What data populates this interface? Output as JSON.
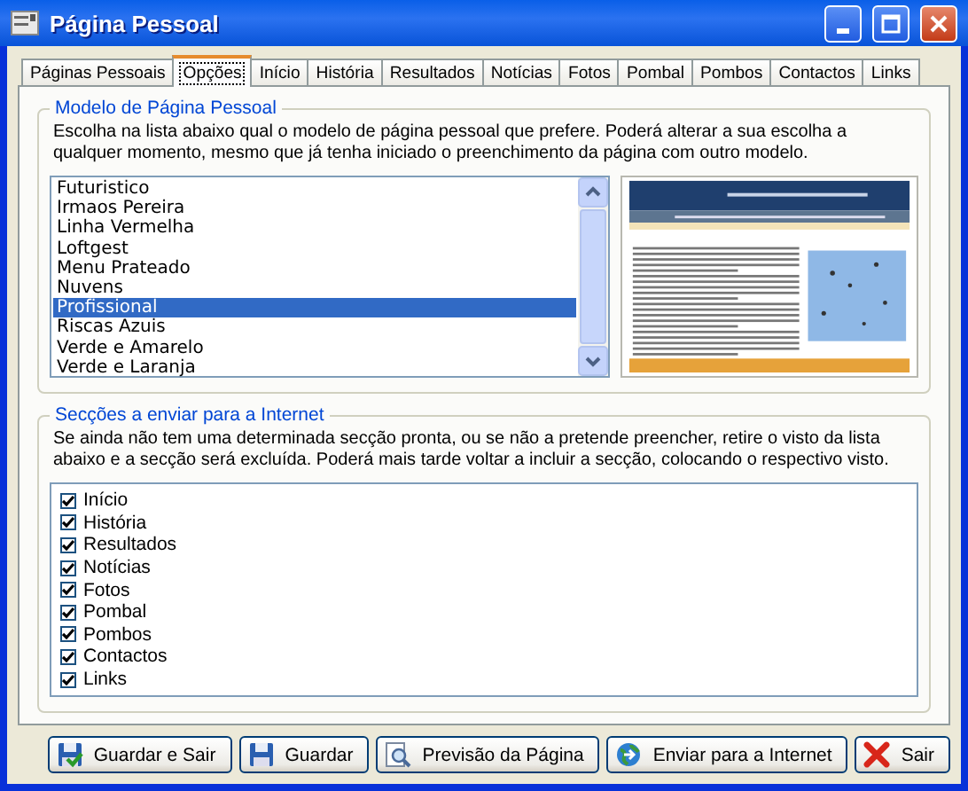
{
  "window": {
    "title": "Página Pessoal"
  },
  "tabs": [
    {
      "label": "Páginas Pessoais",
      "selected": false
    },
    {
      "label": "Opções",
      "selected": true
    },
    {
      "label": "Início",
      "selected": false
    },
    {
      "label": "História",
      "selected": false
    },
    {
      "label": "Resultados",
      "selected": false
    },
    {
      "label": "Notícias",
      "selected": false
    },
    {
      "label": "Fotos",
      "selected": false
    },
    {
      "label": "Pombal",
      "selected": false
    },
    {
      "label": "Pombos",
      "selected": false
    },
    {
      "label": "Contactos",
      "selected": false
    },
    {
      "label": "Links",
      "selected": false
    }
  ],
  "template_group": {
    "title": "Modelo de Página Pessoal",
    "description": "Escolha na lista abaixo qual o modelo de página pessoal que prefere. Poderá alterar a sua escolha a qualquer momento, mesmo que já tenha iniciado o preenchimento da página com outro modelo.",
    "items": [
      {
        "label": "Futuristico",
        "selected": false
      },
      {
        "label": "Irmaos Pereira",
        "selected": false
      },
      {
        "label": "Linha Vermelha",
        "selected": false
      },
      {
        "label": "Loftgest",
        "selected": false
      },
      {
        "label": "Menu Prateado",
        "selected": false
      },
      {
        "label": "Nuvens",
        "selected": false
      },
      {
        "label": "Profissional",
        "selected": true
      },
      {
        "label": "Riscas Azuis",
        "selected": false
      },
      {
        "label": "Verde e Amarelo",
        "selected": false
      },
      {
        "label": "Verde e Laranja",
        "selected": false
      }
    ]
  },
  "sections_group": {
    "title": "Secções a enviar para a Internet",
    "description": "Se ainda não tem uma determinada secção pronta, ou se não a pretende preencher, retire o visto da lista abaixo e a secção será excluída. Poderá mais tarde voltar a incluir a secção, colocando o respectivo visto.",
    "items": [
      {
        "label": "Início",
        "checked": true
      },
      {
        "label": "História",
        "checked": true
      },
      {
        "label": "Resultados",
        "checked": true
      },
      {
        "label": "Notícias",
        "checked": true
      },
      {
        "label": "Fotos",
        "checked": true
      },
      {
        "label": "Pombal",
        "checked": true
      },
      {
        "label": "Pombos",
        "checked": true
      },
      {
        "label": "Contactos",
        "checked": true
      },
      {
        "label": "Links",
        "checked": true
      }
    ]
  },
  "buttons": [
    {
      "label": "Guardar e Sair",
      "kind": "save-exit"
    },
    {
      "label": "Guardar",
      "kind": "save"
    },
    {
      "label": "Previsão da Página",
      "kind": "preview"
    },
    {
      "label": "Enviar para a Internet",
      "kind": "send"
    },
    {
      "label": "Sair",
      "kind": "exit"
    }
  ]
}
